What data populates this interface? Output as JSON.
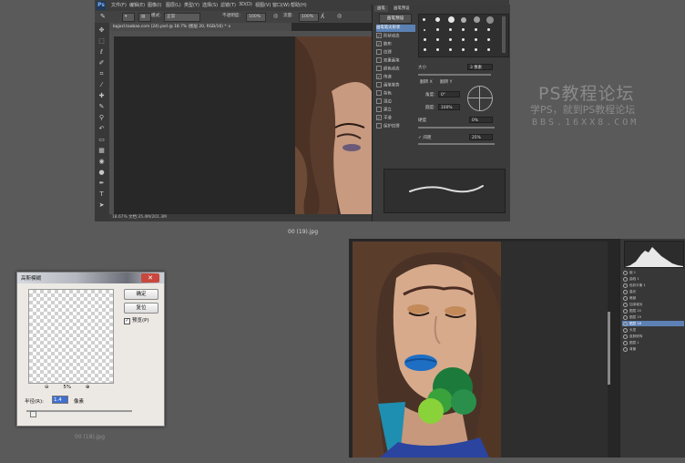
{
  "top_window": {
    "logo": "Ps",
    "menu": [
      "文件(F)",
      "编辑(E)",
      "图像(I)",
      "图层(L)",
      "类型(Y)",
      "选择(S)",
      "滤镜(T)",
      "3D(D)",
      "视图(V)",
      "窗口(W)",
      "帮助(H)"
    ],
    "options": {
      "mode_label": "模式:",
      "mode_value": "正常",
      "opacity_label": "不透明度:",
      "opacity_value": "100%",
      "flow_label": "流量:",
      "flow_value": "100%"
    },
    "doc_tab": "bqjxzl.taobao.com (24).psd @ 18.7% (图层 20, RGB/16) * ×",
    "status": "18.67%    文档:35.4M/201.3M"
  },
  "brush_panel": {
    "tabs": [
      "画笔",
      "画笔预设"
    ],
    "preset_button": "画笔预设",
    "options": [
      {
        "label": "画笔笔尖形状",
        "checked": false,
        "selected": true
      },
      {
        "label": "形状动态",
        "checked": true,
        "selected": false
      },
      {
        "label": "散布",
        "checked": true,
        "selected": false
      },
      {
        "label": "纹理",
        "checked": false,
        "selected": false
      },
      {
        "label": "双重画笔",
        "checked": false,
        "selected": false
      },
      {
        "label": "颜色动态",
        "checked": false,
        "selected": false
      },
      {
        "label": "传递",
        "checked": true,
        "selected": false
      },
      {
        "label": "画笔笔势",
        "checked": false,
        "selected": false
      },
      {
        "label": "杂色",
        "checked": false,
        "selected": false
      },
      {
        "label": "湿边",
        "checked": false,
        "selected": false
      },
      {
        "label": "建立",
        "checked": false,
        "selected": false
      },
      {
        "label": "平滑",
        "checked": true,
        "selected": false
      },
      {
        "label": "保护纹理",
        "checked": false,
        "selected": false
      }
    ],
    "size_label": "大小",
    "size_value": "3 像素",
    "flip_x": "翻转 X",
    "flip_y": "翻转 Y",
    "angle_label": "角度:",
    "angle_value": "0°",
    "roundness_label": "圆度:",
    "roundness_value": "100%",
    "hardness_label": "硬度",
    "hardness_value": "0%",
    "spacing_label": "间距",
    "spacing_value": "25%"
  },
  "caption_top": "00 (19).jpg",
  "watermark": {
    "line1": "PS教程论坛",
    "line2": "学PS，就到PS教程论坛",
    "line3": "BBS.16XX8.COM"
  },
  "dialog": {
    "title": "高斯模糊",
    "close": "✕",
    "ok": "确定",
    "reset": "复位",
    "preview_label": "预览(P)",
    "zoom_value": "5%",
    "radius_label": "半径(R):",
    "radius_value": "1.4",
    "units": "像素"
  },
  "caption_bottom": "00 (18).jpg",
  "layers_panel": {
    "layers": [
      {
        "name": "组 1",
        "selected": false
      },
      {
        "name": "曲线 1",
        "selected": false
      },
      {
        "name": "色彩平衡 1",
        "selected": false
      },
      {
        "name": "高光",
        "selected": false
      },
      {
        "name": "暗部",
        "selected": false
      },
      {
        "name": "加深减淡",
        "selected": false
      },
      {
        "name": "图层 20",
        "selected": false
      },
      {
        "name": "图层 19",
        "selected": false
      },
      {
        "name": "图层 18",
        "selected": true
      },
      {
        "name": "头发",
        "selected": false
      },
      {
        "name": "皮肤修饰",
        "selected": false
      },
      {
        "name": "图层 1",
        "selected": false
      },
      {
        "name": "背景",
        "selected": false
      }
    ]
  },
  "colors": {
    "ps_dark": "#2b2b2b",
    "ps_panel": "#3b3b3b",
    "selection": "#5b81b4",
    "dialog_bg": "#ece9e4",
    "close_red": "#c9473c"
  }
}
